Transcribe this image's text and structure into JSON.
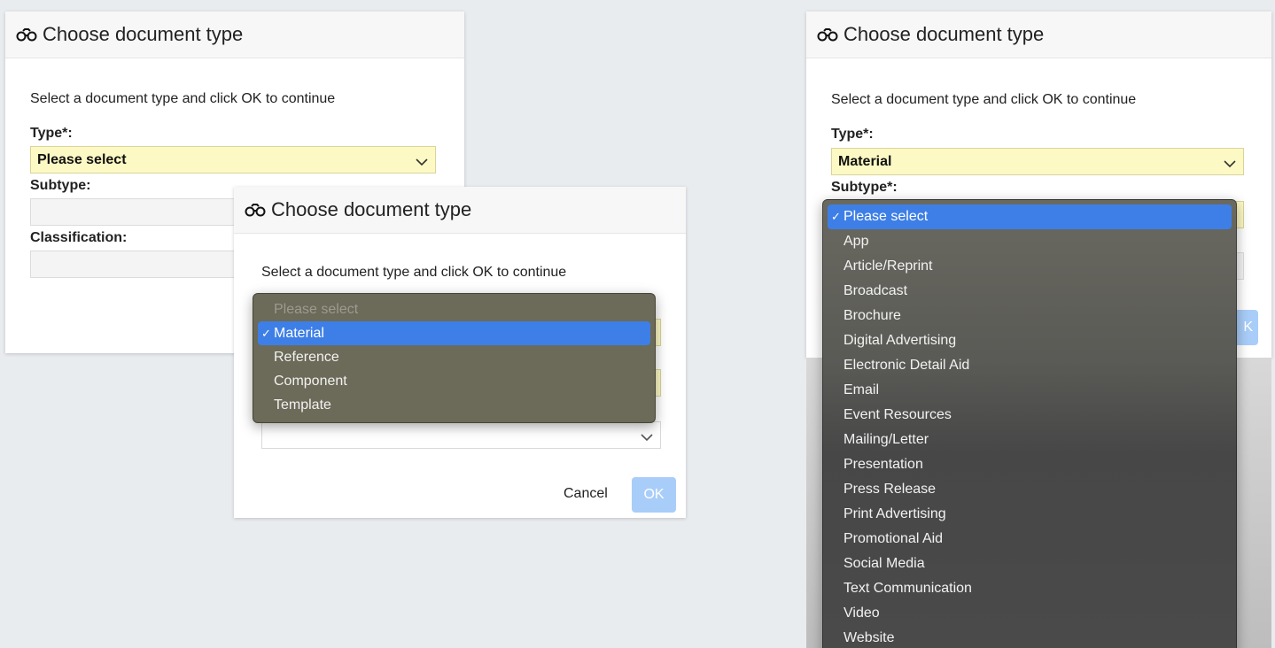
{
  "dialog_title": "Choose document type",
  "instructions": "Select a document type and click OK to continue",
  "dialog1": {
    "type_label": "Type*:",
    "type_value": "Please select",
    "subtype_label": "Subtype:",
    "classification_label": "Classification:"
  },
  "dialog2": {
    "cancel_label": "Cancel",
    "ok_label": "OK",
    "type_options": [
      "Please select",
      "Material",
      "Reference",
      "Component",
      "Template"
    ],
    "selected_option": "Material"
  },
  "dialog3": {
    "type_label": "Type*:",
    "type_value": "Material",
    "subtype_label": "Subtype*:",
    "ok_partial": "K",
    "subtype_options": [
      "Please select",
      "App",
      "Article/Reprint",
      "Broadcast",
      "Brochure",
      "Digital Advertising",
      "Electronic Detail Aid",
      "Email",
      "Event Resources",
      "Mailing/Letter",
      "Presentation",
      "Press Release",
      "Print Advertising",
      "Promotional Aid",
      "Social Media",
      "Text Communication",
      "Video",
      "Website"
    ],
    "selected_option": "Please select"
  },
  "colors": {
    "required_field": "#fdf9c4",
    "selected_option": "#3d7fe6",
    "ok_button": "#a9cdf9"
  },
  "icons": {
    "header_icon": "binoculars-icon",
    "select_chevron": "chevron-down-icon",
    "check": "checkmark-icon"
  }
}
